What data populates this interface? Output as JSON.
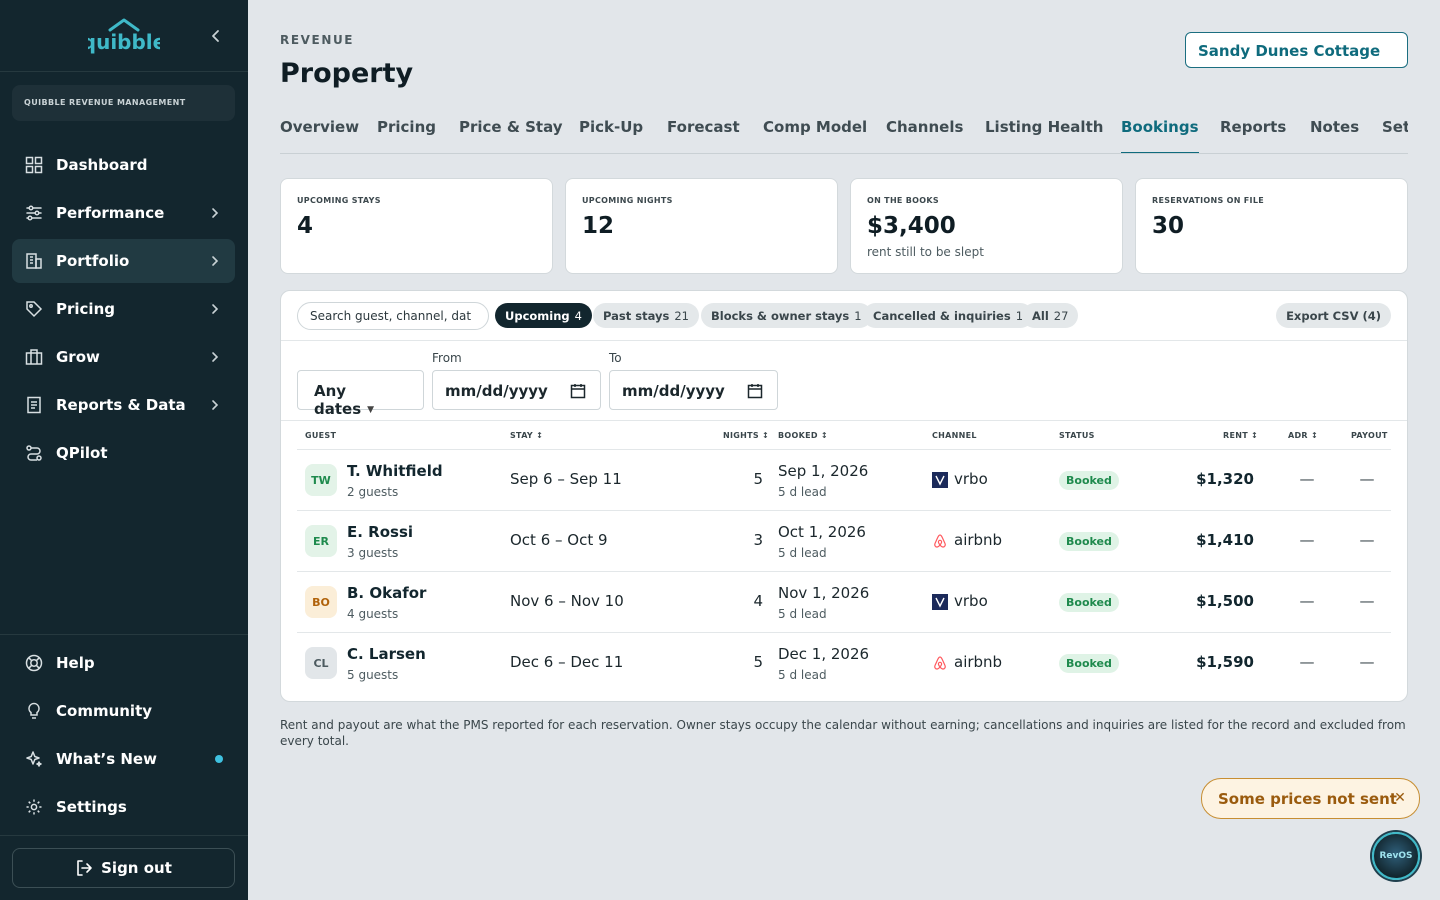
{
  "sidebar": {
    "brand": "quibble",
    "org": "QUIBBLE REVENUE MANAGEMENT",
    "nav": [
      {
        "label": "Dashboard",
        "icon": "grid-icon"
      },
      {
        "label": "Performance",
        "icon": "sliders-icon"
      },
      {
        "label": "Portfolio",
        "icon": "building-icon"
      },
      {
        "label": "Pricing",
        "icon": "tag-icon"
      },
      {
        "label": "Grow",
        "icon": "briefcase-icon"
      },
      {
        "label": "Reports & Data",
        "icon": "report-icon"
      },
      {
        "label": "QPilot",
        "icon": "route-icon"
      }
    ],
    "bottom": [
      {
        "label": "Help",
        "icon": "lifebuoy-icon"
      },
      {
        "label": "Community",
        "icon": "lightbulb-icon"
      },
      {
        "label": "What’s New",
        "icon": "sparkle-icon"
      },
      {
        "label": "Settings",
        "icon": "gear-icon"
      }
    ],
    "signout": "Sign out"
  },
  "header": {
    "eyebrow": "REVENUE",
    "title": "Property",
    "property": "Sandy Dunes Cottage"
  },
  "tabs": [
    "Overview",
    "Pricing",
    "Price & Stay",
    "Pick-Up",
    "Forecast",
    "Comp Model",
    "Channels",
    "Listing Health",
    "Bookings",
    "Reports",
    "Notes",
    "Set"
  ],
  "active_tab": "Bookings",
  "kpis": [
    {
      "label": "UPCOMING STAYS",
      "value": "4",
      "sub": ""
    },
    {
      "label": "UPCOMING NIGHTS",
      "value": "12",
      "sub": ""
    },
    {
      "label": "ON THE BOOKS",
      "value": "$3,400",
      "sub": "rent still to be slept"
    },
    {
      "label": "RESERVATIONS ON FILE",
      "value": "30",
      "sub": ""
    }
  ],
  "filters": {
    "search_placeholder": "Search guest, channel, dat",
    "chips": [
      {
        "label": "Upcoming",
        "count": "4"
      },
      {
        "label": "Past stays",
        "count": "21"
      },
      {
        "label": "Blocks & owner stays",
        "count": "1"
      },
      {
        "label": "Cancelled & inquiries",
        "count": "1"
      },
      {
        "label": "All",
        "count": "27"
      }
    ],
    "export": "Export CSV (4)",
    "any_dates": "Any dates",
    "from_label": "From",
    "to_label": "To",
    "from_value": "mm/dd/yyyy",
    "to_value": "mm/dd/yyyy"
  },
  "table": {
    "headers": {
      "guest": "GUEST",
      "stay": "STAY ↕",
      "nights": "NIGHTS ↕",
      "booked": "BOOKED ↕",
      "channel": "CHANNEL",
      "status": "STATUS",
      "rent": "RENT ↕",
      "adr": "ADR ↕",
      "payout": "PAYOUT"
    },
    "rows": [
      {
        "initials": "TW",
        "name": "T. Whitfield",
        "guests": "2 guests",
        "stay": "Sep 6 – Sep 11",
        "nights": "5",
        "booked": "Sep 1, 2026",
        "lead": "5 d lead",
        "channel": "vrbo",
        "status": "Booked",
        "rent": "$1,320",
        "adr": "—",
        "payout": "—"
      },
      {
        "initials": "ER",
        "name": "E. Rossi",
        "guests": "3 guests",
        "stay": "Oct 6 – Oct 9",
        "nights": "3",
        "booked": "Oct 1, 2026",
        "lead": "5 d lead",
        "channel": "airbnb",
        "status": "Booked",
        "rent": "$1,410",
        "adr": "—",
        "payout": "—"
      },
      {
        "initials": "BO",
        "name": "B. Okafor",
        "guests": "4 guests",
        "stay": "Nov 6 – Nov 10",
        "nights": "4",
        "booked": "Nov 1, 2026",
        "lead": "5 d lead",
        "channel": "vrbo",
        "status": "Booked",
        "rent": "$1,500",
        "adr": "—",
        "payout": "—"
      },
      {
        "initials": "CL",
        "name": "C. Larsen",
        "guests": "5 guests",
        "stay": "Dec 6 – Dec 11",
        "nights": "5",
        "booked": "Dec 1, 2026",
        "lead": "5 d lead",
        "channel": "airbnb",
        "status": "Booked",
        "rent": "$1,590",
        "adr": "—",
        "payout": "—"
      }
    ]
  },
  "footnote": "Rent and payout are what the PMS reported for each reservation. Owner stays occupy the calendar without earning; cancellations and inquiries are listed for the record and excluded from every total.",
  "toast": "Some prices not sent",
  "revos": "RevOS",
  "colors": {
    "sidebar": "#13262e",
    "accent": "#0f6b7d",
    "booked_bg": "#dff3e6",
    "booked_fg": "#1f8a4d",
    "toast_bg": "#fdf3e2",
    "toast_fg": "#9a5b0e"
  }
}
